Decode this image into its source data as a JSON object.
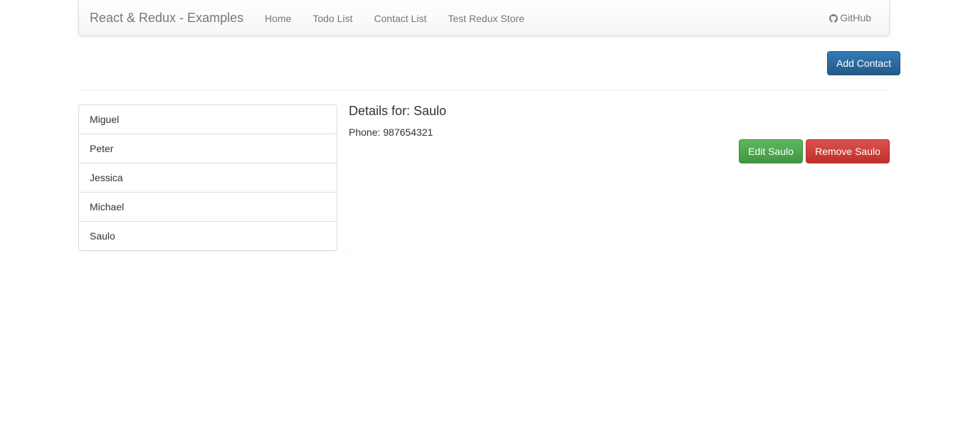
{
  "navbar": {
    "brand": "React & Redux - Examples",
    "links": [
      "Home",
      "Todo List",
      "Contact List",
      "Test Redux Store"
    ],
    "github_label": "GitHub"
  },
  "toolbar": {
    "add_contact_label": "Add Contact"
  },
  "contacts": [
    "Miguel",
    "Peter",
    "Jessica",
    "Michael",
    "Saulo"
  ],
  "details": {
    "title": "Details for: Saulo",
    "phone": "Phone: 987654321",
    "edit_label": "Edit Saulo",
    "remove_label": "Remove Saulo"
  },
  "colors": {
    "primary": "#337ab7",
    "success": "#5cb85c",
    "danger": "#d9534f"
  }
}
